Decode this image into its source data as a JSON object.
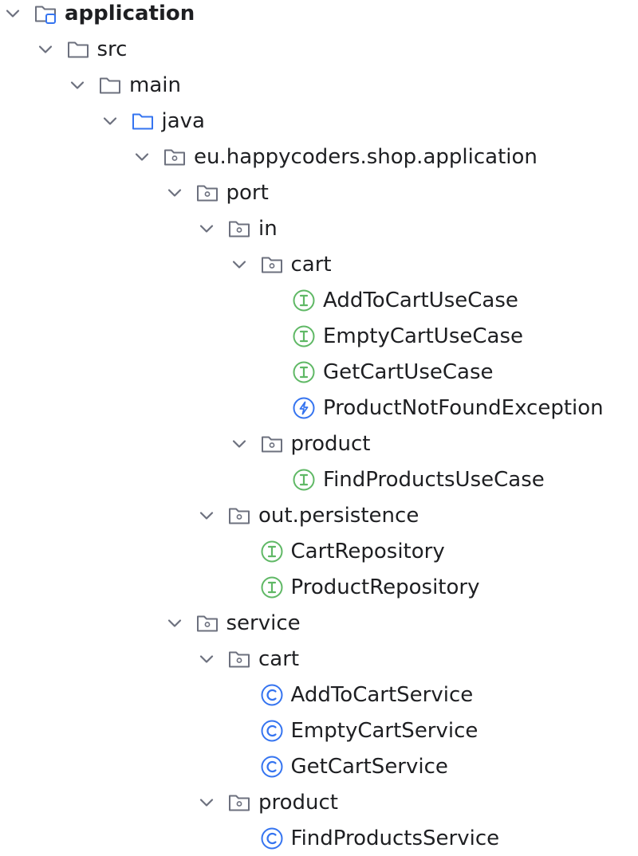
{
  "colors": {
    "chevron": "#6c707e",
    "folder_gray": "#6c707e",
    "folder_blue": "#3574f0",
    "interface_green": "#5fb865",
    "exception_blue": "#3574f0",
    "class_blue": "#3574f0",
    "module_square": "#3574f0"
  },
  "tree": [
    {
      "label": "application",
      "icon": "module-folder-icon",
      "expanded": true,
      "bold": true
    },
    {
      "label": "src",
      "icon": "folder-icon",
      "expanded": true
    },
    {
      "label": "main",
      "icon": "folder-icon",
      "expanded": true
    },
    {
      "label": "java",
      "icon": "source-root-folder-icon",
      "expanded": true
    },
    {
      "label": "eu.happycoders.shop.application",
      "icon": "package-icon",
      "expanded": true
    },
    {
      "label": "port",
      "icon": "package-icon",
      "expanded": true
    },
    {
      "label": "in",
      "icon": "package-icon",
      "expanded": true
    },
    {
      "label": "cart",
      "icon": "package-icon",
      "expanded": true
    },
    {
      "label": "AddToCartUseCase",
      "icon": "interface-icon"
    },
    {
      "label": "EmptyCartUseCase",
      "icon": "interface-icon"
    },
    {
      "label": "GetCartUseCase",
      "icon": "interface-icon"
    },
    {
      "label": "ProductNotFoundException",
      "icon": "exception-icon"
    },
    {
      "label": "product",
      "icon": "package-icon",
      "expanded": true
    },
    {
      "label": "FindProductsUseCase",
      "icon": "interface-icon"
    },
    {
      "label": "out.persistence",
      "icon": "package-icon",
      "expanded": true
    },
    {
      "label": "CartRepository",
      "icon": "interface-icon"
    },
    {
      "label": "ProductRepository",
      "icon": "interface-icon"
    },
    {
      "label": "service",
      "icon": "package-icon",
      "expanded": true
    },
    {
      "label": "cart",
      "icon": "package-icon",
      "expanded": true
    },
    {
      "label": "AddToCartService",
      "icon": "class-icon"
    },
    {
      "label": "EmptyCartService",
      "icon": "class-icon"
    },
    {
      "label": "GetCartService",
      "icon": "class-icon"
    },
    {
      "label": "product",
      "icon": "package-icon",
      "expanded": true
    },
    {
      "label": "FindProductsService",
      "icon": "class-icon"
    }
  ]
}
